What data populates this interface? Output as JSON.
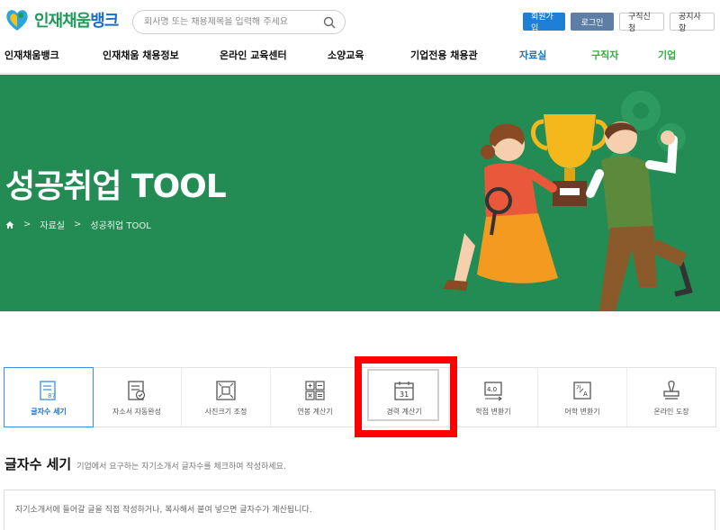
{
  "header": {
    "logo_part1": "인재채움",
    "logo_part2": "뱅크",
    "search_placeholder": "회사명 또는 채용제목을 입력해 주세요",
    "buttons": [
      "회원가입",
      "로그인",
      "구직신청",
      "공지사항"
    ]
  },
  "nav": {
    "items": [
      "인재채움뱅크",
      "인재채움 채용정보",
      "온라인 교육센터",
      "소양교육",
      "기업전용 채용관",
      "자료실",
      "구직자",
      "기업"
    ]
  },
  "hero": {
    "title": "성공취업 TOOL",
    "breadcrumb": [
      "자료실",
      "성공취업 TOOL"
    ],
    "sep": ">"
  },
  "tools": {
    "items": [
      {
        "label": "글자수 세기",
        "icon": "text-count-icon"
      },
      {
        "label": "자소서 자동완성",
        "icon": "checklist-icon"
      },
      {
        "label": "사진크기 조정",
        "icon": "resize-icon"
      },
      {
        "label": "연봉 계산기",
        "icon": "calculator-icon"
      },
      {
        "label": "경력 계산기",
        "icon": "calendar-icon"
      },
      {
        "label": "학점 변환기",
        "icon": "grade-convert-icon"
      },
      {
        "label": "어학 변환기",
        "icon": "language-convert-icon"
      },
      {
        "label": "온라인 도장",
        "icon": "stamp-icon"
      }
    ],
    "tool_icon_texts": {
      "count": "87",
      "calendar": "31",
      "grade": "4.0",
      "lang_a": "가",
      "lang_b": "A"
    }
  },
  "section": {
    "title": "글자수 세기",
    "subtitle": "기업에서 요구하는 자기소개서 글자수를 체크하여 작성하세요.",
    "textarea_placeholder": "자기소개서에 들어갈 글을 직접 작성하거나, 복사해서 붙여 넣으면 글자수가 계산됩니다."
  },
  "colors": {
    "hero_bg": "#238c54",
    "highlight": "#ff0000",
    "accent_blue": "#1a6fc9",
    "accent_green": "#2fae3c"
  }
}
